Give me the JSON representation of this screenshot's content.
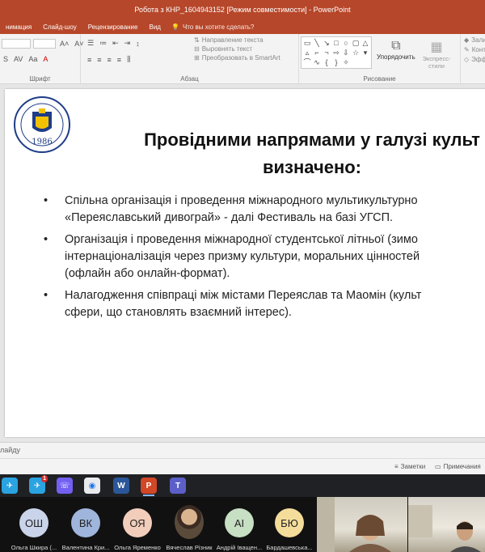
{
  "window": {
    "title": "Робота з КНР_1604943152 [Режим совместимости] - PowerPoint"
  },
  "menu": {
    "items": [
      "нимация",
      "Слайд-шоу",
      "Рецензирование",
      "Вид"
    ],
    "search_placeholder": "Что вы хотите сделать?"
  },
  "ribbon": {
    "groups": {
      "font": "Шрифт",
      "paragraph": "Абзац",
      "drawing": "Рисование"
    },
    "text_direction": "Направление текста",
    "align_text": "Выровнять текст",
    "smartart": "Преобразовать в SmartArt",
    "arrange": "Упорядочить",
    "quick_styles": "Экспресс-стили",
    "right_items": [
      "Зали",
      "Конт",
      "Эфф"
    ]
  },
  "slide": {
    "logo_year": "1986",
    "title_line1": "Провідними напрямами у галузі культ",
    "title_line2": "визначено:",
    "bullets": [
      {
        "lines": [
          "Спільна організація і проведення міжнародного мультикультурно",
          "«Переяславський дивограй» - далі Фестиваль на базі УГСП."
        ]
      },
      {
        "lines": [
          "Організація і проведення міжнародної студентської літньої (зимо",
          "інтернаціоналізація через призму культури, моральних цінностей",
          "(офлайн або онлайн-формат)."
        ]
      },
      {
        "lines": [
          "Налагодження співпраці між містами Переяслав та Маомін (культ",
          "сфери, що становлять взаємний інтерес)."
        ]
      }
    ]
  },
  "notes": {
    "placeholder": "лайду"
  },
  "status": {
    "notes": "Заметки",
    "comments": "Примечания"
  },
  "taskbar": {
    "icons": [
      {
        "name": "telegram-icon",
        "glyph": "✈",
        "color": "#2aa3e0"
      },
      {
        "name": "telegram-badge-icon",
        "glyph": "✈",
        "color": "#2aa3e0",
        "badge": "1"
      },
      {
        "name": "viber-icon",
        "glyph": "☏",
        "color": "#7360f2"
      },
      {
        "name": "chrome-icon",
        "glyph": "◉",
        "color": "#e8eaed"
      },
      {
        "name": "word-icon",
        "glyph": "W",
        "color": "#2b579a"
      },
      {
        "name": "powerpoint-icon",
        "glyph": "P",
        "color": "#d24726"
      },
      {
        "name": "teams-icon",
        "glyph": "T",
        "color": "#5b5fc7"
      }
    ]
  },
  "participants": [
    {
      "initials": "ОШ",
      "name": "Ольга Шкира (...",
      "color": "#c9d3ea"
    },
    {
      "initials": "ВК",
      "name": "Валентина Кри...",
      "color": "#9fb5dc"
    },
    {
      "initials": "ОЯ",
      "name": "Ольга Яременко",
      "color": "#f2cdbb"
    },
    {
      "initials": "",
      "name": "Вячеслав Різник",
      "color": ""
    },
    {
      "initials": "АІ",
      "name": "Андрій Іващен...",
      "color": "#c7dfc3"
    },
    {
      "initials": "БЮ",
      "name": "Бардашевська...",
      "color": "#f4dc9a"
    }
  ]
}
